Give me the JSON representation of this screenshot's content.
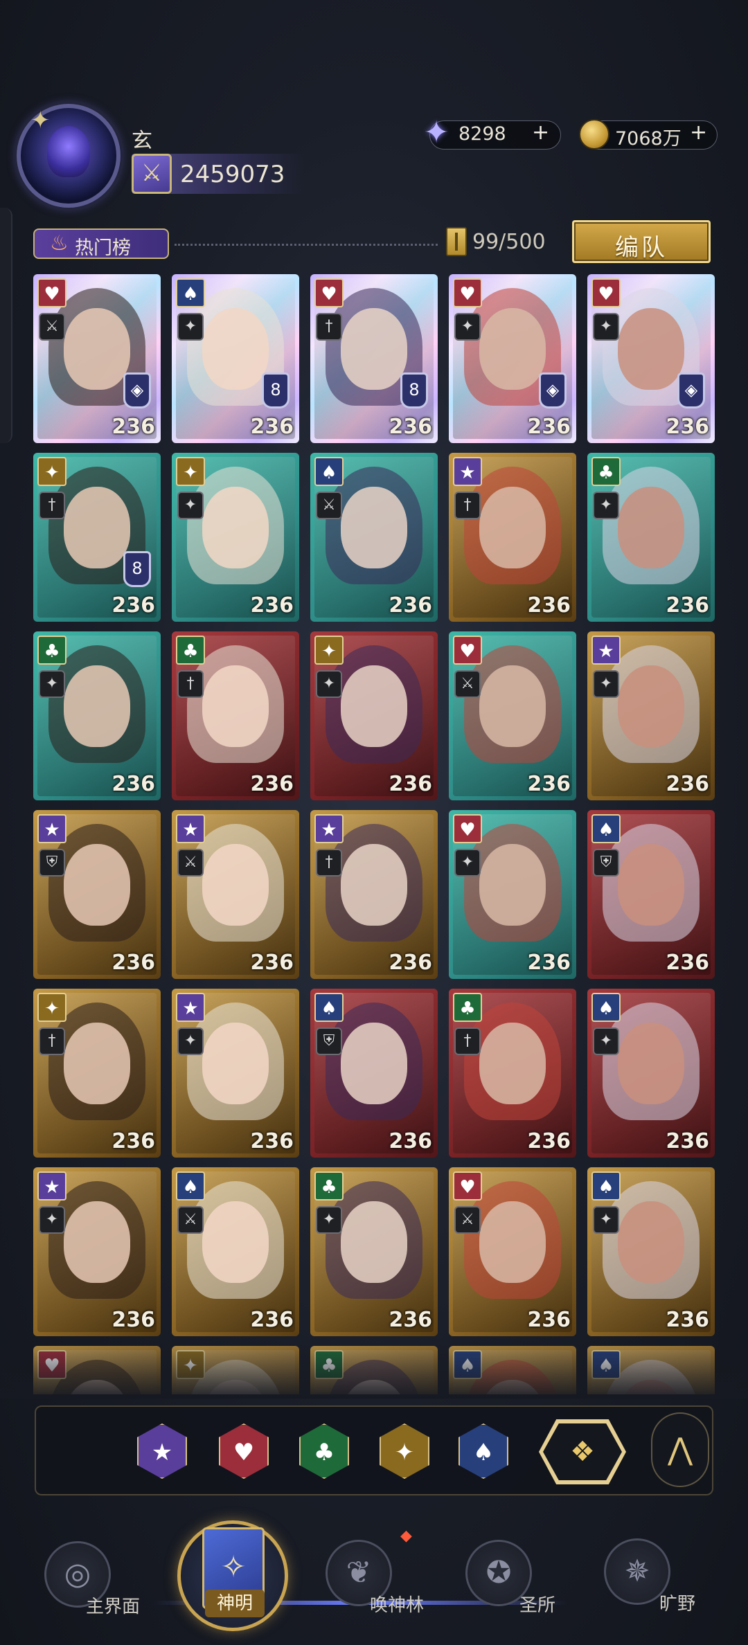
{
  "player": {
    "name": "玄",
    "power": "2459073"
  },
  "currency": {
    "gems": "8298",
    "gold": "7068万",
    "plus": "+"
  },
  "toolbar": {
    "hot_label": "热门榜",
    "capacity": "99/500",
    "team_label": "编队"
  },
  "colors": {
    "gold_accent": "#c9a451",
    "teal_rarity": "#2f8e89",
    "gold_rarity": "#8a6424",
    "red_rarity": "#7a2326"
  },
  "cards": [
    {
      "suit": "heart-icon",
      "suit_glyph": "♥",
      "rarity": "rainbow",
      "role": "⚔",
      "level": "236",
      "badge": "◈"
    },
    {
      "suit": "spade-icon",
      "suit_glyph": "♠",
      "rarity": "rainbow",
      "role": "✦",
      "level": "236",
      "badge": "8"
    },
    {
      "suit": "heart-icon",
      "suit_glyph": "♥",
      "rarity": "rainbow",
      "role": "†",
      "level": "236",
      "badge": "8"
    },
    {
      "suit": "heart-icon",
      "suit_glyph": "♥",
      "rarity": "rainbow",
      "role": "✦",
      "level": "236",
      "badge": "◈"
    },
    {
      "suit": "heart-icon",
      "suit_glyph": "♥",
      "rarity": "rainbow",
      "role": "✦",
      "level": "236",
      "badge": "◈"
    },
    {
      "suit": "diamond-icon",
      "suit_glyph": "✦",
      "rarity": "teal",
      "role": "†",
      "level": "236",
      "badge": "8"
    },
    {
      "suit": "diamond-icon",
      "suit_glyph": "✦",
      "rarity": "teal",
      "role": "✦",
      "level": "236"
    },
    {
      "suit": "spade-icon",
      "suit_glyph": "♠",
      "rarity": "teal",
      "role": "⚔",
      "level": "236"
    },
    {
      "suit": "star-icon",
      "suit_glyph": "★",
      "rarity": "gold",
      "role": "†",
      "level": "236"
    },
    {
      "suit": "club-icon",
      "suit_glyph": "♣",
      "rarity": "teal",
      "role": "✦",
      "level": "236"
    },
    {
      "suit": "club-icon",
      "suit_glyph": "♣",
      "rarity": "teal",
      "role": "✦",
      "level": "236"
    },
    {
      "suit": "club-icon",
      "suit_glyph": "♣",
      "rarity": "red",
      "role": "†",
      "level": "236"
    },
    {
      "suit": "diamond-icon",
      "suit_glyph": "✦",
      "rarity": "red",
      "role": "✦",
      "level": "236"
    },
    {
      "suit": "heart-icon",
      "suit_glyph": "♥",
      "rarity": "teal",
      "role": "⚔",
      "level": "236"
    },
    {
      "suit": "star-icon",
      "suit_glyph": "★",
      "rarity": "gold",
      "role": "✦",
      "level": "236"
    },
    {
      "suit": "star-icon",
      "suit_glyph": "★",
      "rarity": "gold",
      "role": "⛨",
      "level": "236"
    },
    {
      "suit": "star-icon",
      "suit_glyph": "★",
      "rarity": "gold",
      "role": "⚔",
      "level": "236"
    },
    {
      "suit": "star-icon",
      "suit_glyph": "★",
      "rarity": "gold",
      "role": "†",
      "level": "236"
    },
    {
      "suit": "heart-icon",
      "suit_glyph": "♥",
      "rarity": "teal",
      "role": "✦",
      "level": "236"
    },
    {
      "suit": "spade-icon",
      "suit_glyph": "♠",
      "rarity": "red",
      "role": "⛨",
      "level": "236"
    },
    {
      "suit": "diamond-icon",
      "suit_glyph": "✦",
      "rarity": "gold",
      "role": "†",
      "level": "236"
    },
    {
      "suit": "star-icon",
      "suit_glyph": "★",
      "rarity": "gold",
      "role": "✦",
      "level": "236"
    },
    {
      "suit": "spade-icon",
      "suit_glyph": "♠",
      "rarity": "red",
      "role": "⛨",
      "level": "236"
    },
    {
      "suit": "club-icon",
      "suit_glyph": "♣",
      "rarity": "red",
      "role": "†",
      "level": "236"
    },
    {
      "suit": "spade-icon",
      "suit_glyph": "♠",
      "rarity": "red",
      "role": "✦",
      "level": "236"
    },
    {
      "suit": "star-icon",
      "suit_glyph": "★",
      "rarity": "gold",
      "role": "✦",
      "level": "236"
    },
    {
      "suit": "spade-icon",
      "suit_glyph": "♠",
      "rarity": "gold",
      "role": "⚔",
      "level": "236"
    },
    {
      "suit": "club-icon",
      "suit_glyph": "♣",
      "rarity": "gold",
      "role": "✦",
      "level": "236"
    },
    {
      "suit": "heart-icon",
      "suit_glyph": "♥",
      "rarity": "gold",
      "role": "⚔",
      "level": "236"
    },
    {
      "suit": "spade-icon",
      "suit_glyph": "♠",
      "rarity": "gold",
      "role": "✦",
      "level": "236"
    },
    {
      "suit": "heart-icon",
      "suit_glyph": "♥",
      "rarity": "gold",
      "role": "",
      "level": ""
    },
    {
      "suit": "diamond-icon",
      "suit_glyph": "✦",
      "rarity": "gold",
      "role": "",
      "level": ""
    },
    {
      "suit": "club-icon",
      "suit_glyph": "♣",
      "rarity": "gold",
      "role": "",
      "level": ""
    },
    {
      "suit": "spade-icon",
      "suit_glyph": "♠",
      "rarity": "gold",
      "role": "",
      "level": ""
    },
    {
      "suit": "spade-icon",
      "suit_glyph": "♠",
      "rarity": "gold",
      "role": "",
      "level": ""
    }
  ],
  "filters": [
    {
      "name": "filter-star-button",
      "glyph": "★",
      "color": "#5a3e9c"
    },
    {
      "name": "filter-heart-button",
      "glyph": "♥",
      "color": "#9c2e3b"
    },
    {
      "name": "filter-club-button",
      "glyph": "♣",
      "color": "#1f6a39"
    },
    {
      "name": "filter-diamond-button",
      "glyph": "✦",
      "color": "#8a6a1f"
    },
    {
      "name": "filter-spade-button",
      "glyph": "♠",
      "color": "#27407c"
    }
  ],
  "filter_all_glyph": "❖",
  "collapse_glyph": "⋀",
  "nav": {
    "main_world": "主界面",
    "gods": "神明",
    "summon": "唤神林",
    "sanctuary": "圣所",
    "wilds": "旷野"
  }
}
